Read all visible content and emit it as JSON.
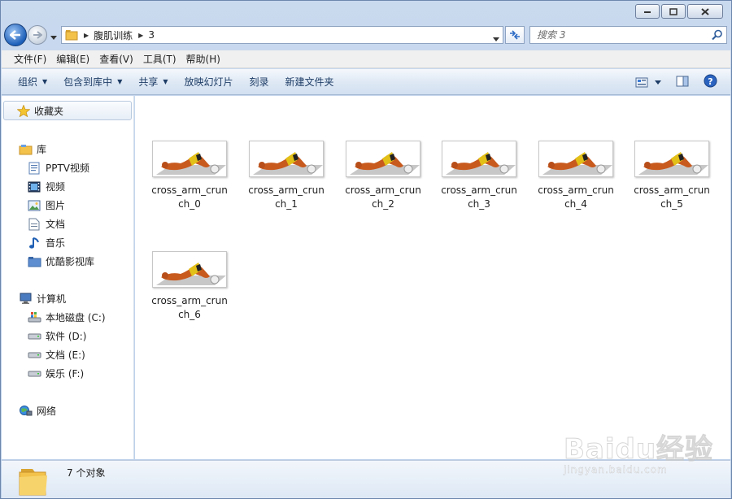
{
  "window": {
    "caption_buttons": [
      "minimize-icon",
      "maximize-icon",
      "close-icon"
    ]
  },
  "address": {
    "crumbs": [
      "腹肌训练",
      "3"
    ]
  },
  "search": {
    "placeholder": "搜索 3"
  },
  "menubar": {
    "items": [
      "文件(F)",
      "编辑(E)",
      "查看(V)",
      "工具(T)",
      "帮助(H)"
    ]
  },
  "commandbar": {
    "items": [
      {
        "label": "组织",
        "has_arrow": true
      },
      {
        "label": "包含到库中",
        "has_arrow": true
      },
      {
        "label": "共享",
        "has_arrow": true
      },
      {
        "label": "放映幻灯片",
        "has_arrow": false
      },
      {
        "label": "刻录",
        "has_arrow": false
      },
      {
        "label": "新建文件夹",
        "has_arrow": false
      }
    ]
  },
  "navpane": {
    "favorites": "收藏夹",
    "library": {
      "label": "库",
      "items": [
        "PPTV视频",
        "视频",
        "图片",
        "文档",
        "音乐",
        "优酷影视库"
      ]
    },
    "computer": {
      "label": "计算机",
      "items": [
        "本地磁盘 (C:)",
        "软件 (D:)",
        "文档 (E:)",
        "娱乐 (F:)"
      ]
    },
    "network": "网络"
  },
  "files": [
    "cross_arm_crunch_0",
    "cross_arm_crunch_1",
    "cross_arm_crunch_2",
    "cross_arm_crunch_3",
    "cross_arm_crunch_4",
    "cross_arm_crunch_5",
    "cross_arm_crunch_6"
  ],
  "status": {
    "count": "7 个对象"
  },
  "watermark": {
    "text": "Baidu经验",
    "sub": "jingyan.baidu.com"
  },
  "colors": {
    "accent": "#1d5fb9",
    "cmd_text": "#1e3d66"
  }
}
